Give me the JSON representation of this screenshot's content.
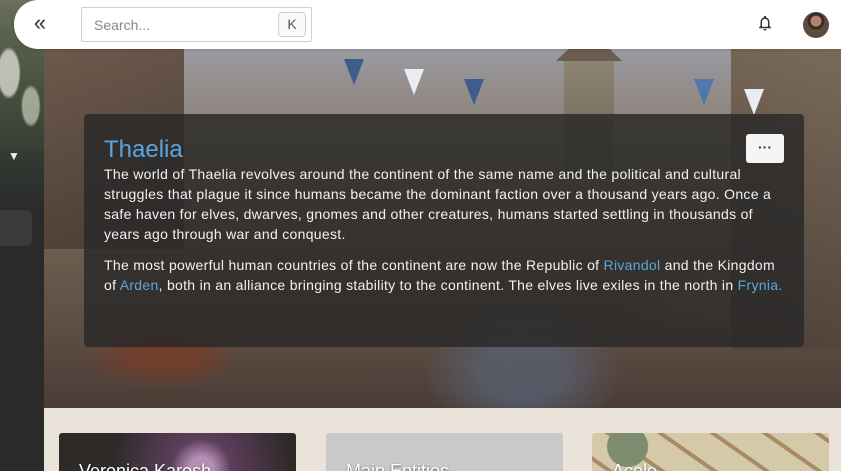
{
  "topbar": {
    "collapse_icon": "double-chevron-left-icon",
    "search_placeholder": "Search...",
    "search_shortcut": "K",
    "notifications_icon": "bell-icon",
    "avatar_icon": "user-avatar"
  },
  "sidebar": {
    "toggle_icon": "caret-down-icon"
  },
  "entity": {
    "title": "Thaelia",
    "menu_label": "···",
    "paragraph1": "The world of Thaelia revolves around the continent of the same name and the political and cultural struggles that plague it since humans became the dominant faction over a thousand years ago. Once a safe haven for elves, dwarves, gnomes and other creatures, humans started settling in thousands of years ago through war and conquest.",
    "paragraph2_part1": "The most powerful human countries of the continent are now the Republic of ",
    "link_rivandol": "Rivandol",
    "paragraph2_part2": " and the Kingdom of ",
    "link_arden": "Arden",
    "paragraph2_part3": ", both in an alliance bringing stability to the continent. The elves live exiles in the north in ",
    "link_frynia": "Frynia."
  },
  "tiles": [
    {
      "label": "Veronica Karosh"
    },
    {
      "label": "Main Entities"
    },
    {
      "label": "Acole"
    }
  ],
  "colors": {
    "accent": "#5aa7e0",
    "card_bg": "#282828"
  }
}
